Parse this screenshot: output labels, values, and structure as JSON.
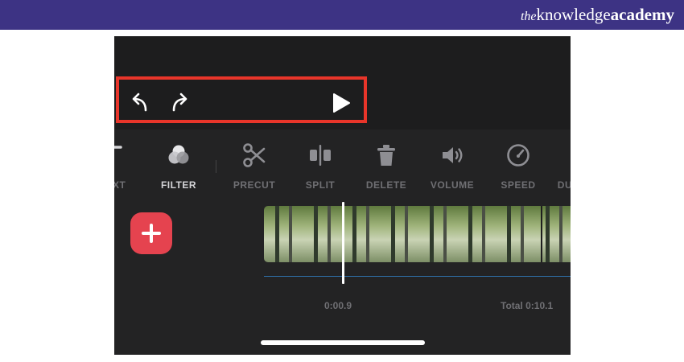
{
  "brand": {
    "prefix": "the",
    "knowledge": "knowledge",
    "academy": "academy"
  },
  "controls": {
    "undo_icon": "undo-icon",
    "redo_icon": "redo-icon",
    "play_icon": "play-icon"
  },
  "toolbar": {
    "items": [
      {
        "label": "TEXT",
        "icon": "text-icon"
      },
      {
        "label": "FILTER",
        "icon": "filter-icon"
      },
      {
        "label": "PRECUT",
        "icon": "scissors-icon"
      },
      {
        "label": "SPLIT",
        "icon": "split-icon"
      },
      {
        "label": "DELETE",
        "icon": "trash-icon"
      },
      {
        "label": "VOLUME",
        "icon": "volume-icon"
      },
      {
        "label": "SPEED",
        "icon": "speedometer-icon"
      },
      {
        "label": "DURATION",
        "icon": "duration-icon"
      }
    ],
    "active": "FILTER"
  },
  "timeline": {
    "current_time": "0:00.9",
    "total_time": "Total 0:10.1",
    "add_icon": "plus-icon"
  },
  "colors": {
    "banner": "#3d3384",
    "highlight": "#e8352a",
    "add_button": "#e5434f",
    "audio_line": "#2e6fa8",
    "background": "#232324"
  }
}
